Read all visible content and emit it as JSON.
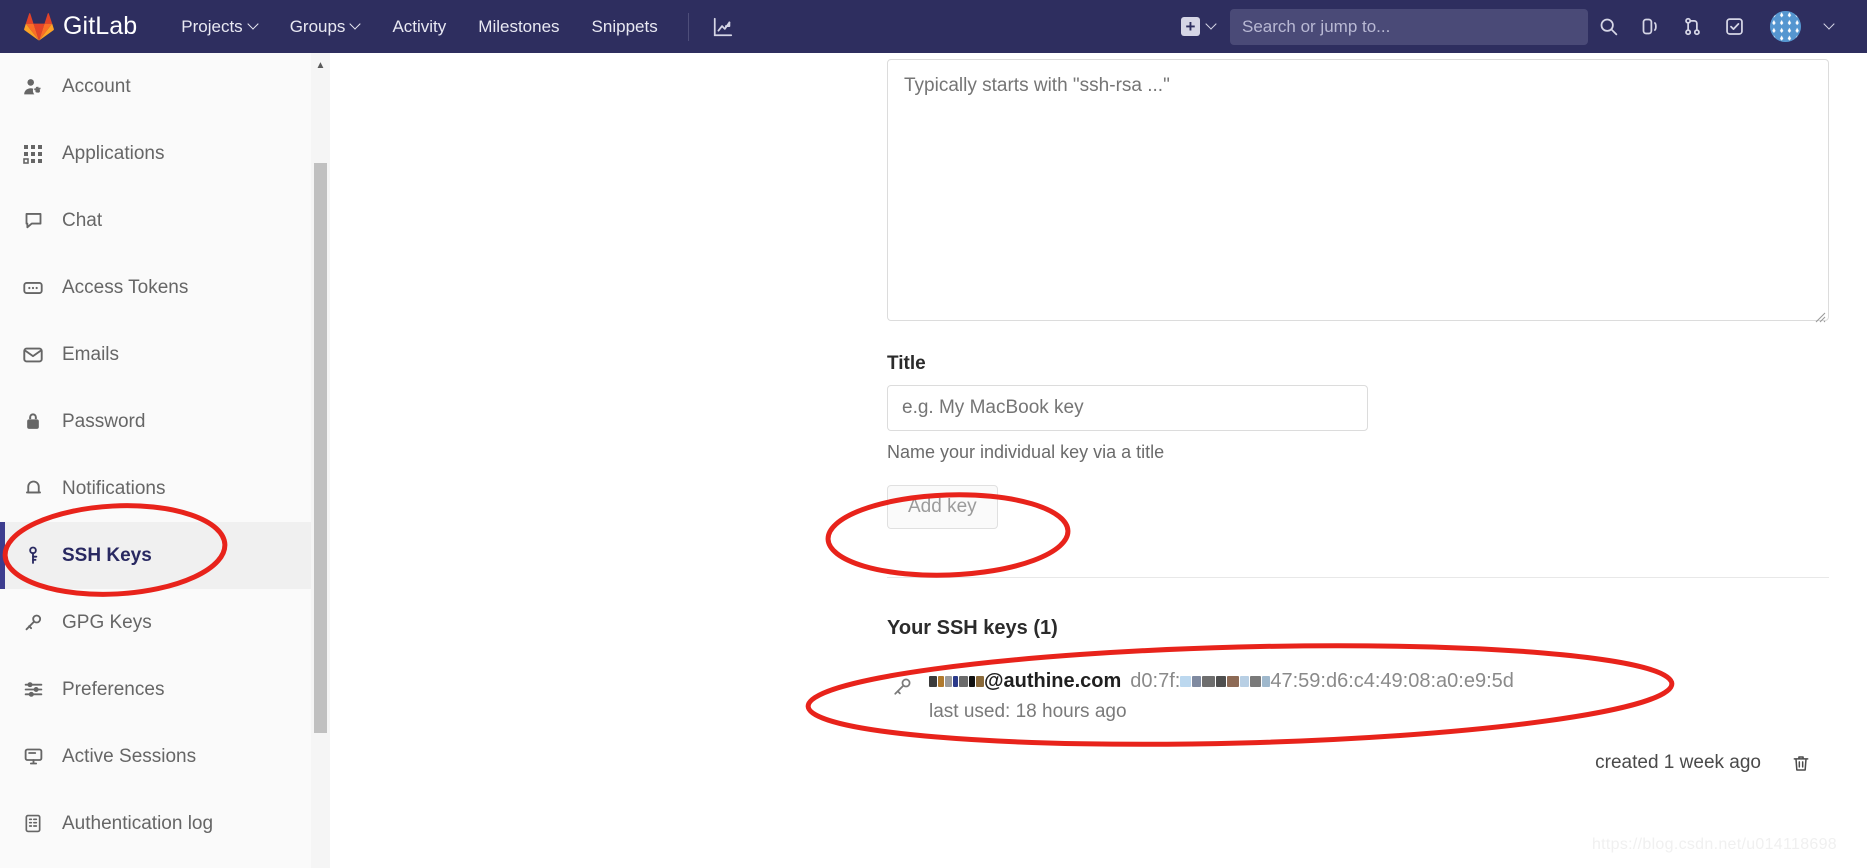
{
  "navbar": {
    "brand": "GitLab",
    "brand_icon": "gitlab-logo-icon",
    "links": [
      {
        "label": "Projects",
        "icon": "chevron-down-icon",
        "has_chevron": true
      },
      {
        "label": "Groups",
        "icon": "chevron-down-icon",
        "has_chevron": true
      },
      {
        "label": "Activity",
        "has_chevron": false
      },
      {
        "label": "Milestones",
        "has_chevron": false
      },
      {
        "label": "Snippets",
        "has_chevron": false
      }
    ],
    "analytics_icon": "analytics-chart-icon",
    "create_new": {
      "icon": "plus-square-icon",
      "chevron": "chevron-down-icon"
    },
    "search": {
      "placeholder": "Search or jump to...",
      "icon": "search-icon"
    },
    "right_icons": [
      {
        "name": "issues-icon"
      },
      {
        "name": "merge-requests-icon"
      },
      {
        "name": "todos-done-icon"
      }
    ],
    "avatar": {
      "name": "user-avatar",
      "chevron": "chevron-down-icon"
    },
    "background": "#2e2e5f"
  },
  "sidebar": {
    "items": [
      {
        "label": "Account",
        "icon": "user-settings-icon",
        "active": false
      },
      {
        "label": "Applications",
        "icon": "grid-apps-icon",
        "active": false
      },
      {
        "label": "Chat",
        "icon": "chat-bubble-icon",
        "active": false
      },
      {
        "label": "Access Tokens",
        "icon": "token-icon",
        "active": false
      },
      {
        "label": "Emails",
        "icon": "envelope-icon",
        "active": false
      },
      {
        "label": "Password",
        "icon": "lock-icon",
        "active": false
      },
      {
        "label": "Notifications",
        "icon": "bell-icon",
        "active": false
      },
      {
        "label": "SSH Keys",
        "icon": "key-icon",
        "active": true
      },
      {
        "label": "GPG Keys",
        "icon": "key-outline-icon",
        "active": false
      },
      {
        "label": "Preferences",
        "icon": "sliders-icon",
        "active": false
      },
      {
        "label": "Active Sessions",
        "icon": "monitor-icon",
        "active": false
      },
      {
        "label": "Authentication log",
        "icon": "log-book-icon",
        "active": false
      }
    ],
    "active_color": "#292961",
    "scrollbar": {
      "name": "sidebar-scrollbar"
    }
  },
  "main": {
    "key_textarea": {
      "placeholder": "Typically starts with \"ssh-rsa ...\"",
      "value": ""
    },
    "title_field": {
      "label": "Title",
      "placeholder": "e.g. My MacBook key",
      "value": "",
      "help": "Name your individual key via a title"
    },
    "add_key_button": "Add key",
    "keys_heading": "Your SSH keys (1)",
    "key_entry": {
      "owner_suffix": "@authine.com",
      "fingerprint_prefix": "d0:7f:",
      "fingerprint_suffix": "47:59:d6:c4:49:08:a0:e9:5d",
      "last_used": "last used: 18 hours ago",
      "created": "created 1 week ago",
      "key_icon": "key-icon",
      "delete_icon": "trash-icon"
    }
  },
  "annotations": {
    "color": "#e8231b",
    "shapes": [
      {
        "name": "annotation-ellipse-ssh-keys-nav"
      },
      {
        "name": "annotation-ellipse-add-key"
      },
      {
        "name": "annotation-ellipse-key-entry"
      }
    ]
  },
  "watermark": "https://blog.csdn.net/u014118698"
}
